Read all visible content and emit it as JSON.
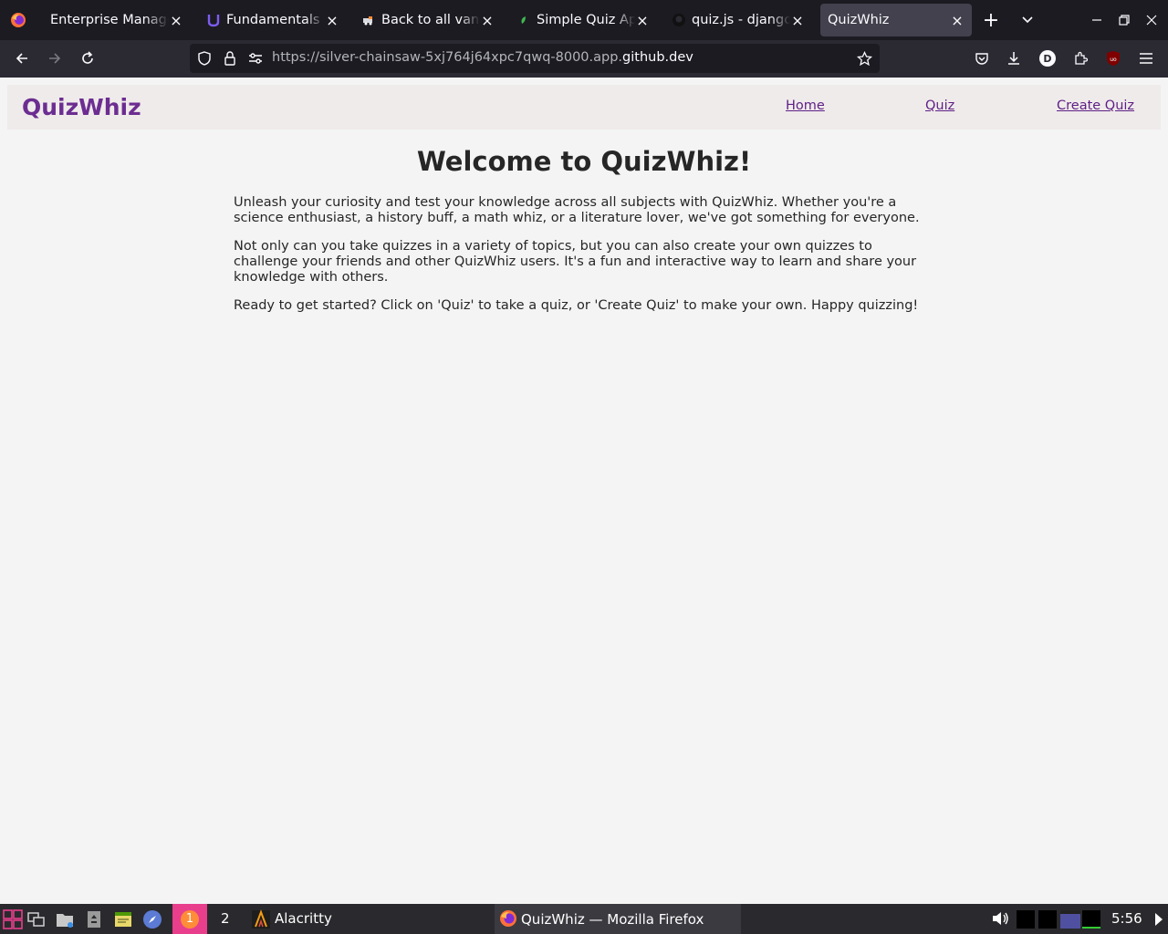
{
  "browser": {
    "tabs": [
      {
        "title": "Enterprise Management",
        "icon": "firefox-ext-icon",
        "active": false
      },
      {
        "title": "Fundamentals of",
        "icon": "udemy-icon",
        "active": false
      },
      {
        "title": "Back to all vans",
        "icon": "van-icon",
        "active": false
      },
      {
        "title": "Simple Quiz App",
        "icon": "leaf-icon",
        "active": false
      },
      {
        "title": "quiz.js - django-quiz",
        "icon": "github-icon",
        "active": false
      },
      {
        "title": "QuizWhiz",
        "icon": "",
        "active": true
      }
    ],
    "url": {
      "prefix": "https://silver-chainsaw-5xj764j64xpc7qwq-8000.app.",
      "domain": "github.dev"
    },
    "profile_initial": "D",
    "ublock_label": "uo"
  },
  "site": {
    "brand": "QuizWhiz",
    "nav": [
      {
        "label": "Home"
      },
      {
        "label": "Quiz"
      },
      {
        "label": "Create Quiz"
      }
    ],
    "heading": "Welcome to QuizWhiz!",
    "paragraphs": [
      "Unleash your curiosity and test your knowledge across all subjects with QuizWhiz. Whether you're a science enthusiast, a history buff, a math whiz, or a literature lover, we've got something for everyone.",
      "Not only can you take quizzes in a variety of topics, but you can also create your own quizzes to challenge your friends and other QuizWhiz users. It's a fun and interactive way to learn and share your knowledge with others.",
      "Ready to get started? Click on 'Quiz' to take a quiz, or 'Create Quiz' to make your own. Happy quizzing!"
    ]
  },
  "taskbar": {
    "workspaces": [
      "1",
      "2"
    ],
    "apps": [
      {
        "label": "Alacritty"
      },
      {
        "label": "QuizWhiz — Mozilla Firefox"
      }
    ],
    "clock": "5:56"
  },
  "colors": {
    "brand": "#6c2d91",
    "link": "#5e1f86",
    "header_bg": "#efebea",
    "page_bg": "#f4f4f4",
    "active_workspace": "#e83e8c"
  }
}
